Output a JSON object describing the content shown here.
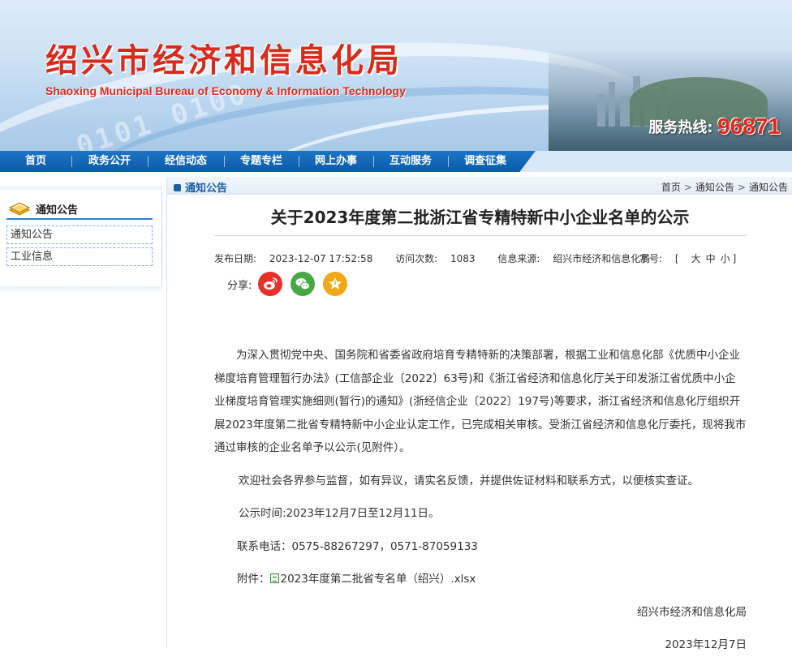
{
  "site": {
    "title_cn": "绍兴市经济和信息化局",
    "title_en": "Shaoxing Municipal Bureau of Economy & Information Technology",
    "banner_digits": "0101 0100",
    "hotline_label": "服务热线:",
    "hotline_number": "96871"
  },
  "nav": {
    "items": [
      "首页",
      "政务公开",
      "经信动态",
      "专题专栏",
      "网上办事",
      "互动服务",
      "调查征集"
    ]
  },
  "sidebar": {
    "title": "通知公告",
    "links": [
      "通知公告",
      "工业信息"
    ]
  },
  "section": {
    "name": "通知公告",
    "breadcrumb": [
      "首页",
      "通知公告",
      "通知公告"
    ],
    "separator": ">"
  },
  "article": {
    "title": "关于2023年度第二批浙江省专精特新中小企业名单的公示",
    "publish_label": "发布日期:",
    "publish_date": "2023-12-07 17:52:58",
    "visits_label": "访问次数:",
    "visits": "1083",
    "source_label": "信息来源:",
    "source": "绍兴市经济和信息化局",
    "fontsize_label": "字号:",
    "fontsize_open": "[",
    "fontsize_large": "大",
    "fontsize_medium": "中",
    "fontsize_small": "小",
    "fontsize_close": "]",
    "share_label": "分享:",
    "body_p1": "为深入贯彻党中央、国务院和省委省政府培育专精特新的决策部署，根据工业和信息化部《优质中小企业梯度培育管理暂行办法》(工信部企业〔2022〕63号)和《浙江省经济和信息化厅关于印发浙江省优质中小企业梯度培育管理实施细则(暂行)的通知》(浙经信企业〔2022〕197号)等要求，浙江省经济和信息化厅组织开展2023年度第二批省专精特新中小企业认定工作，已完成相关审核。受浙江省经济和信息化厅委托，现将我市通过审核的企业名单予以公示(见附件）。",
    "body_p2": "欢迎社会各界参与监督，如有异议，请实名反馈，并提供佐证材料和联系方式，以便核实查证。",
    "period": "公示时间:2023年12月7日至12月11日。",
    "contact": "联系电话：0575-88267297，0571-87059133",
    "attachment_label": "附件：",
    "attachment_name": "2023年度第二批省专名单（绍兴）.xlsx",
    "signature": "绍兴市经济和信息化局",
    "sign_date": "2023年12月7日"
  },
  "colors": {
    "brand_red": "#d92a1c",
    "nav_blue": "#0b5aa8",
    "link_blue": "#1a5fa8"
  }
}
